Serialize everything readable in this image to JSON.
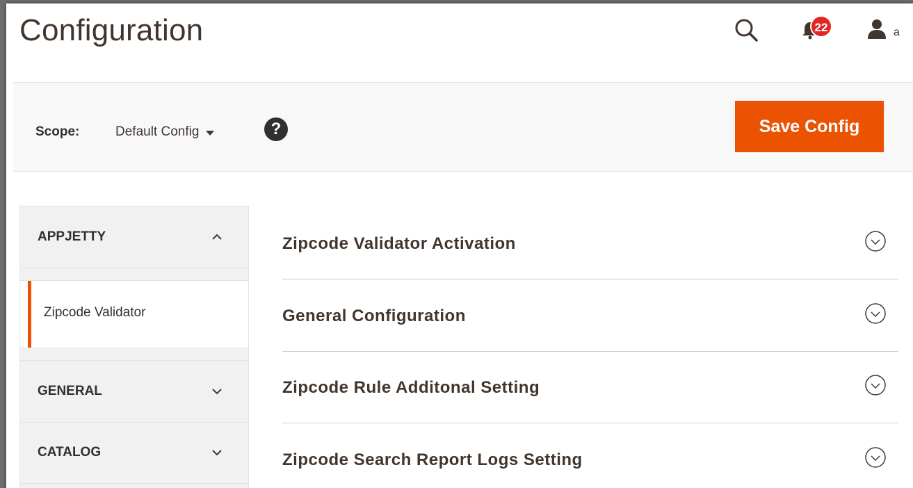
{
  "header": {
    "title": "Configuration",
    "notification_count": "22",
    "user_name_partial": "a"
  },
  "scope": {
    "label": "Scope:",
    "value": "Default Config",
    "help": "?"
  },
  "actions": {
    "save_label": "Save Config",
    "save_color": "#eb5202"
  },
  "sidebar": {
    "groups": [
      {
        "label": "APPJETTY",
        "state": "expanded",
        "items": [
          {
            "label": "Zipcode Validator",
            "active": true
          }
        ]
      },
      {
        "label": "GENERAL",
        "state": "collapsed"
      },
      {
        "label": "CATALOG",
        "state": "collapsed"
      }
    ]
  },
  "sections": [
    {
      "title": "Zipcode Validator Activation"
    },
    {
      "title": "General Configuration"
    },
    {
      "title": "Zipcode Rule Additonal Setting"
    },
    {
      "title": "Zipcode Search Report Logs Setting"
    }
  ],
  "icons": {
    "search": "search-icon",
    "notifications": "bell-icon",
    "user": "user-icon",
    "help": "help-icon",
    "expand": "chevron-circle-down-icon"
  }
}
